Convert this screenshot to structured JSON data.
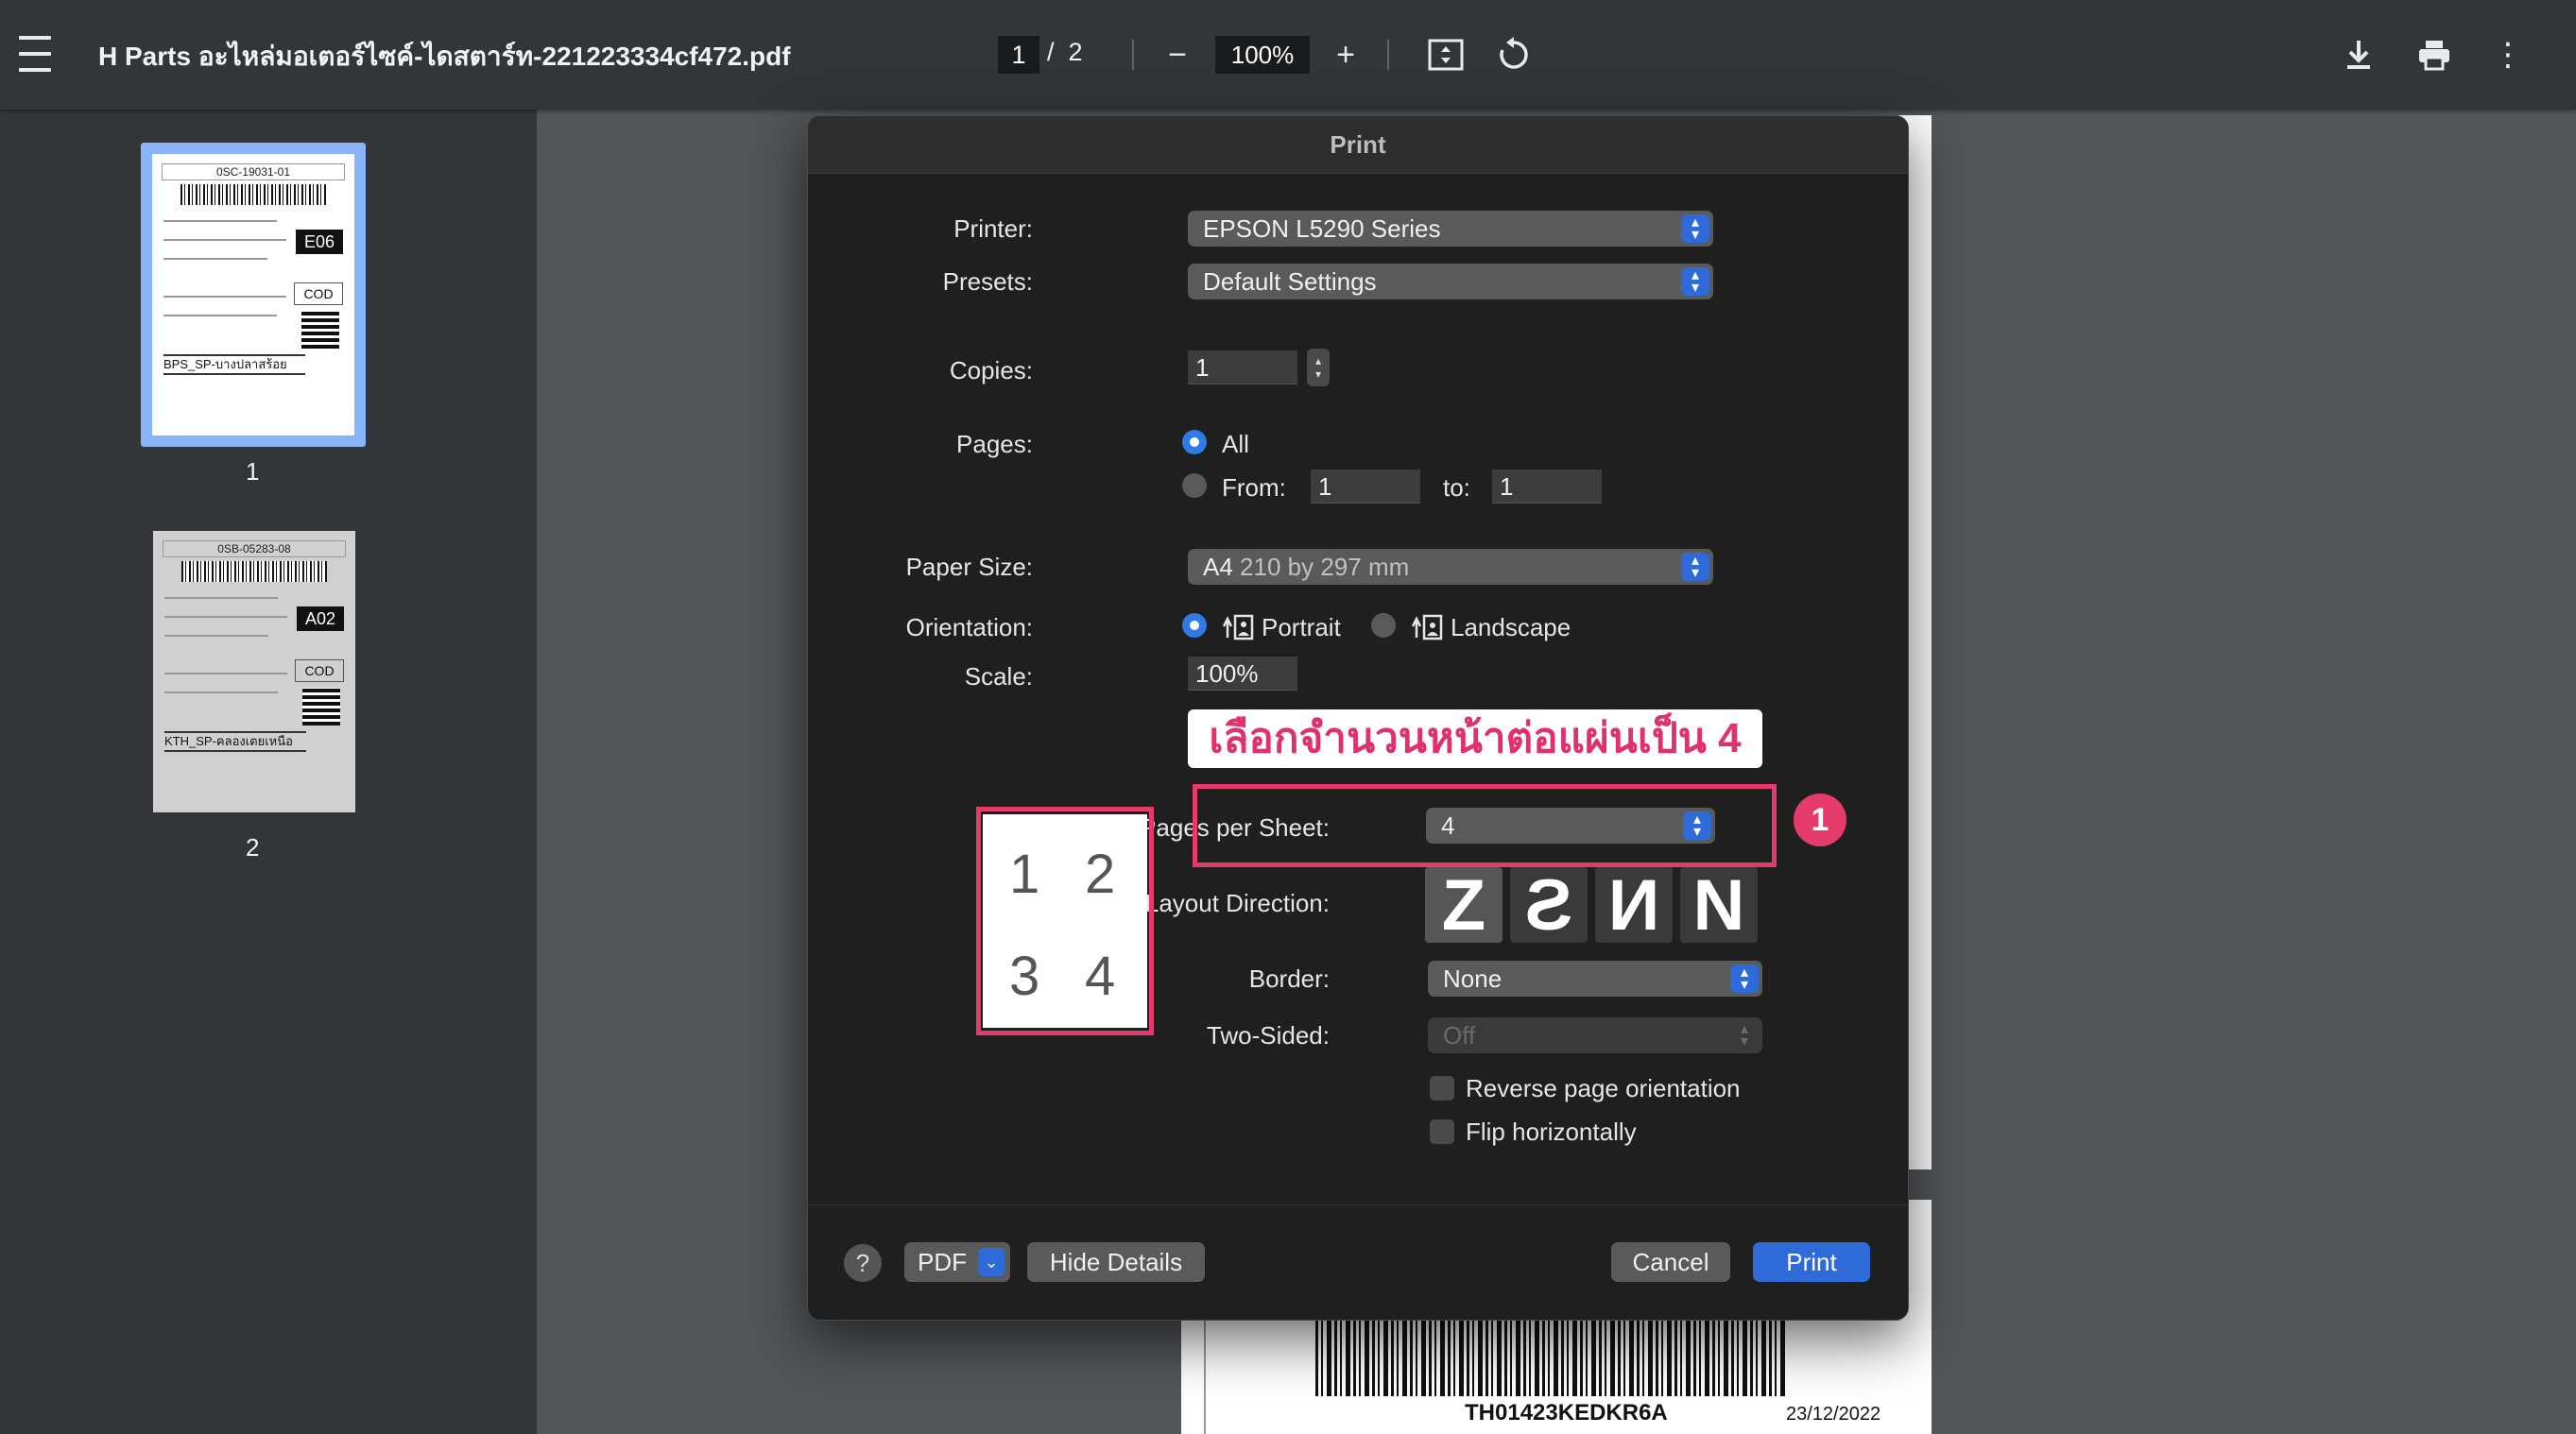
{
  "viewer": {
    "title": "H Parts อะไหล่มอเตอร์ไซค์-ไดสตาร์ท-221223334cf472.pdf",
    "current_page": "1",
    "page_sep": "/",
    "total_pages": "2",
    "zoom": "100%",
    "zoom_out": "−",
    "zoom_in": "+",
    "download": "⭳",
    "print": "🖶",
    "more": "⋮"
  },
  "thumbnails": [
    {
      "number": "1",
      "header": "0SC-19031-01",
      "code": "E06",
      "cod": "COD",
      "tag": "BPS_SP-บางปลาสร้อย"
    },
    {
      "number": "2",
      "header": "0SB-05283-08",
      "code": "A02",
      "cod": "COD",
      "tag": "KTH_SP-คลองเตยเหนือ"
    }
  ],
  "page_peek": {
    "tracking": "TH01423KEDKR6A",
    "date": "23/12/2022"
  },
  "dialog": {
    "title": "Print",
    "printer_label": "Printer:",
    "printer_value": "EPSON L5290 Series",
    "presets_label": "Presets:",
    "presets_value": "Default Settings",
    "copies_label": "Copies:",
    "copies_value": "1",
    "pages_label": "Pages:",
    "pages_all": "All",
    "pages_from": "From:",
    "pages_from_value": "1",
    "pages_to": "to:",
    "pages_to_value": "1",
    "paper_label": "Paper Size:",
    "paper_value": "A4",
    "paper_detail": "210 by 297 mm",
    "orientation_label": "Orientation:",
    "portrait": "Portrait",
    "landscape": "Landscape",
    "scale_label": "Scale:",
    "scale_value": "100%",
    "pps_label": "Pages per Sheet:",
    "pps_value": "4",
    "layout_label": "Layout Direction:",
    "layout_options": [
      "Z",
      "Ƨ",
      "И",
      "N"
    ],
    "border_label": "Border:",
    "border_value": "None",
    "twosided_label": "Two-Sided:",
    "twosided_value": "Off",
    "reverse_label": "Reverse page orientation",
    "flip_label": "Flip horizontally",
    "preview_numbers": [
      "1",
      "2",
      "3",
      "4"
    ],
    "help": "?",
    "pdf_label": "PDF",
    "hide_details": "Hide Details",
    "cancel": "Cancel",
    "print": "Print"
  },
  "annotation": {
    "text": "เลือกจำนวนหน้าต่อแผ่นเป็น 4",
    "badge": "1",
    "color": "#e43b6a"
  }
}
